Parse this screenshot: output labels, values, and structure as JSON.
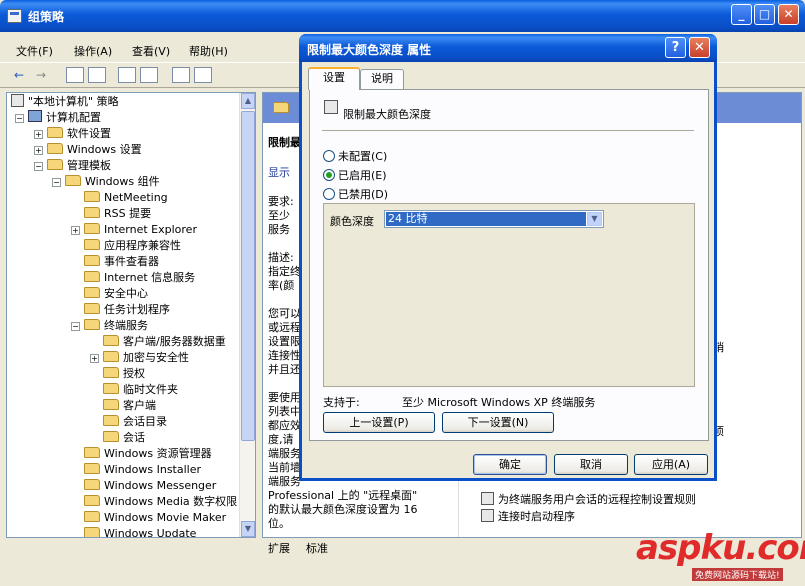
{
  "window": {
    "title": "组策略",
    "min_label": "_",
    "max_label": "□",
    "close_label": "✕"
  },
  "menu": [
    {
      "label": "文件(F)"
    },
    {
      "label": "操作(A)"
    },
    {
      "label": "查看(V)"
    },
    {
      "label": "帮助(H)"
    }
  ],
  "toolbar": {
    "back": "←",
    "forward": "→"
  },
  "tree": {
    "items": [
      {
        "label": "\"本地计算机\" 策略",
        "icon": "policy-icon",
        "expander": ""
      },
      {
        "label": "计算机配置",
        "icon": "computer-icon",
        "expander": "−"
      },
      {
        "label": "软件设置",
        "icon": "folder-icon",
        "expander": "+"
      },
      {
        "label": "Windows 设置",
        "icon": "folder-icon",
        "expander": "+"
      },
      {
        "label": "管理模板",
        "icon": "folder-icon",
        "expander": "−"
      },
      {
        "label": "Windows 组件",
        "icon": "folder-icon",
        "expander": "−"
      },
      {
        "label": "NetMeeting",
        "icon": "folder-icon",
        "expander": ""
      },
      {
        "label": "RSS 提要",
        "icon": "folder-icon",
        "expander": ""
      },
      {
        "label": "Internet Explorer",
        "icon": "folder-icon",
        "expander": "+"
      },
      {
        "label": "应用程序兼容性",
        "icon": "folder-icon",
        "expander": ""
      },
      {
        "label": "事件查看器",
        "icon": "folder-icon",
        "expander": ""
      },
      {
        "label": "Internet 信息服务",
        "icon": "folder-icon",
        "expander": ""
      },
      {
        "label": "安全中心",
        "icon": "folder-icon",
        "expander": ""
      },
      {
        "label": "任务计划程序",
        "icon": "folder-icon",
        "expander": ""
      },
      {
        "label": "终端服务",
        "icon": "folder-icon",
        "expander": "−"
      },
      {
        "label": "客户端/服务器数据重",
        "icon": "folder-icon",
        "expander": ""
      },
      {
        "label": "加密与安全性",
        "icon": "folder-icon",
        "expander": "+"
      },
      {
        "label": "授权",
        "icon": "folder-icon",
        "expander": ""
      },
      {
        "label": "临时文件夹",
        "icon": "folder-icon",
        "expander": ""
      },
      {
        "label": "客户端",
        "icon": "folder-icon",
        "expander": ""
      },
      {
        "label": "会话目录",
        "icon": "folder-icon",
        "expander": ""
      },
      {
        "label": "会话",
        "icon": "folder-icon",
        "expander": ""
      },
      {
        "label": "Windows 资源管理器",
        "icon": "folder-icon",
        "expander": ""
      },
      {
        "label": "Windows Installer",
        "icon": "folder-icon",
        "expander": ""
      },
      {
        "label": "Windows Messenger",
        "icon": "folder-icon",
        "expander": ""
      },
      {
        "label": "Windows Media 数字权限",
        "icon": "folder-icon",
        "expander": ""
      },
      {
        "label": "Windows Movie Maker",
        "icon": "folder-icon",
        "expander": ""
      },
      {
        "label": "Windows Update",
        "icon": "folder-icon",
        "expander": ""
      }
    ]
  },
  "right_pane": {
    "heading": "限制最",
    "display": "显示",
    "req1": "要求:",
    "req2": "至少",
    "req3": "服务",
    "desc1": "描述:",
    "desc2": "指定终",
    "desc3": "率(颜",
    "p1": "您可以",
    "p2": "或远程",
    "p3": "设置限",
    "p4": "连接性",
    "p5": "并且还",
    "q1": "要使用",
    "q2": "列表中",
    "q3": "都应效",
    "q4": "度,请",
    "q5": "端服务",
    "q6": "当前墙",
    "q7": "端服务",
    "tail1": "Professional 上的 \"远程桌面\"",
    "tail2": "的默认最大颜色深度设置为 16",
    "tail3": "位。",
    "item_right1": "销",
    "item_right2": "项",
    "list1": "为终端服务用户会话的远程控制设置规则",
    "list2": "连接时启动程序"
  },
  "bottom_tabs": [
    {
      "label": "扩展"
    },
    {
      "label": "标准"
    }
  ],
  "watermark": {
    "text": "aspku.com",
    "sub": "免费网站源码下载站!"
  },
  "dialog": {
    "title": "限制最大颜色深度 属性",
    "help_label": "?",
    "close_label": "✕",
    "tabs": [
      {
        "label": "设置"
      },
      {
        "label": "说明"
      }
    ],
    "setting_name": "限制最大颜色深度",
    "radios": [
      {
        "label": "未配置(C)",
        "selected": false
      },
      {
        "label": "已启用(E)",
        "selected": true
      },
      {
        "label": "已禁用(D)",
        "selected": false
      }
    ],
    "color_depth_label": "颜色深度",
    "color_depth_value": "24 比特",
    "supported_label": "支持于:",
    "supported_value": "至少 Microsoft Windows XP 终端服务",
    "prev_label": "上一设置(P)",
    "next_label": "下一设置(N)",
    "ok_label": "确定",
    "cancel_label": "取消",
    "apply_label": "应用(A)"
  }
}
